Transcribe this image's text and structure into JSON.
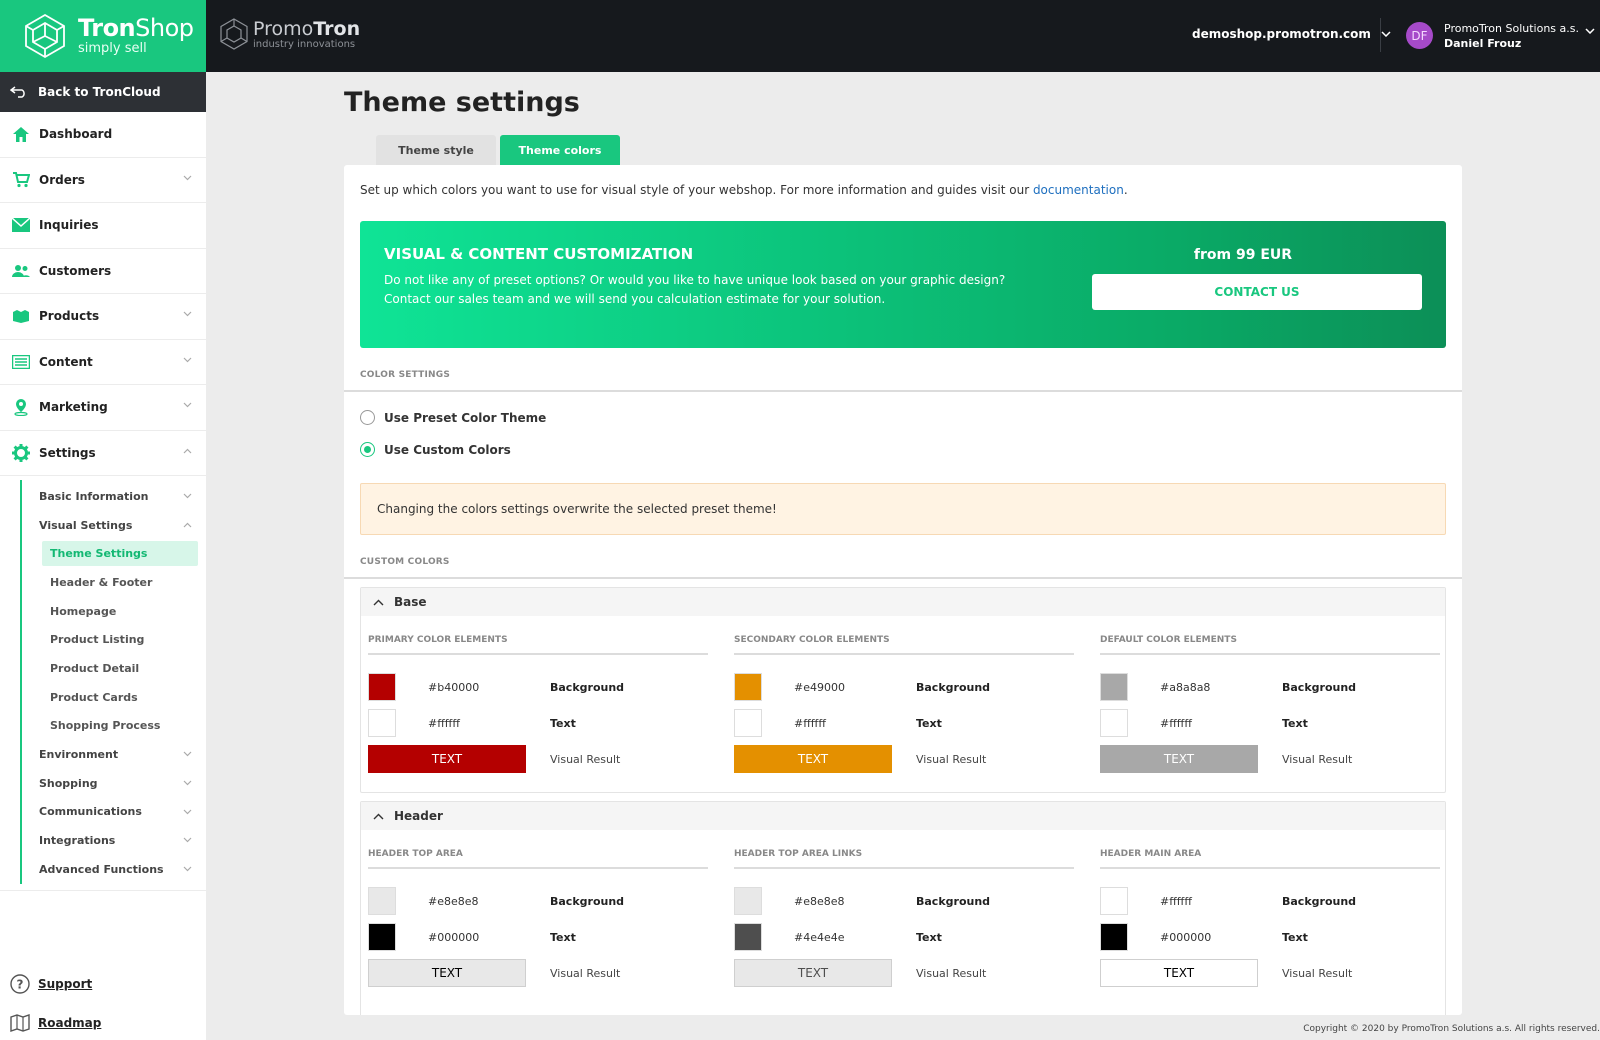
{
  "brand": {
    "name_bold": "Tron",
    "name_light": "Shop",
    "tagline": "simply sell"
  },
  "partner": {
    "name_light": "Promo",
    "name_bold": "Tron",
    "tagline": "industry innovations"
  },
  "topbar": {
    "shop": "demoshop.promotron.com",
    "avatar_initials": "DF",
    "company": "PromoTron Solutions a.s.",
    "user": "Daniel Frouz"
  },
  "sidebar": {
    "back_label": "Back to TronCloud",
    "items": [
      {
        "label": "Dashboard",
        "icon": "home-icon"
      },
      {
        "label": "Orders",
        "icon": "cart-icon"
      },
      {
        "label": "Inquiries",
        "icon": "envelope-icon"
      },
      {
        "label": "Customers",
        "icon": "users-icon"
      },
      {
        "label": "Products",
        "icon": "box-icon"
      },
      {
        "label": "Content",
        "icon": "list-icon"
      },
      {
        "label": "Marketing",
        "icon": "pin-icon"
      },
      {
        "label": "Settings",
        "icon": "gear-icon"
      }
    ],
    "settings_sub": [
      "Basic Information",
      "Visual Settings",
      "Environment",
      "Shopping",
      "Communications",
      "Integrations",
      "Advanced Functions"
    ],
    "visual_sub": [
      "Theme Settings",
      "Header & Footer",
      "Homepage",
      "Product Listing",
      "Product Detail",
      "Product Cards",
      "Shopping Process"
    ],
    "support": "Support",
    "roadmap": "Roadmap"
  },
  "main": {
    "title": "Theme settings",
    "tabs": [
      "Theme style",
      "Theme colors"
    ],
    "intro_text": "Set up which colors you want to use for visual style of your webshop. For more information and guides visit our ",
    "intro_link": "documentation",
    "intro_end": ".",
    "promo": {
      "title": "VISUAL & CONTENT CUSTOMIZATION",
      "text": "Do not like any of preset options? Or would you like to have unique look based on your graphic design? Contact our sales team and we will send you calculation estimate for your solution.",
      "price": "from 99 EUR",
      "button": "CONTACT US"
    },
    "color_settings_label": "COLOR SETTINGS",
    "radio_preset": "Use Preset Color Theme",
    "radio_custom": "Use Custom Colors",
    "warning": "Changing the colors settings overwrite the selected preset theme!",
    "custom_colors_label": "CUSTOM COLORS",
    "row_labels": {
      "background": "Background",
      "text": "Text",
      "visual_result": "Visual Result",
      "sample": "TEXT"
    },
    "groups": [
      {
        "name": "Base",
        "columns": [
          {
            "title": "PRIMARY COLOR ELEMENTS",
            "bg": "#b40000",
            "text": "#ffffff"
          },
          {
            "title": "SECONDARY COLOR ELEMENTS",
            "bg": "#e49000",
            "text": "#ffffff"
          },
          {
            "title": "DEFAULT COLOR ELEMENTS",
            "bg": "#a8a8a8",
            "text": "#ffffff"
          }
        ]
      },
      {
        "name": "Header",
        "columns": [
          {
            "title": "HEADER TOP AREA",
            "bg": "#e8e8e8",
            "text": "#000000"
          },
          {
            "title": "HEADER TOP AREA LINKS",
            "bg": "#e8e8e8",
            "text": "#4e4e4e"
          },
          {
            "title": "HEADER MAIN AREA",
            "bg": "#ffffff",
            "text": "#000000"
          }
        ]
      }
    ]
  },
  "footer": "Copyright © 2020 by PromoTron Solutions a.s. All rights reserved.",
  "colors": {
    "accent": "#19c77f",
    "topbar": "#16191d"
  }
}
